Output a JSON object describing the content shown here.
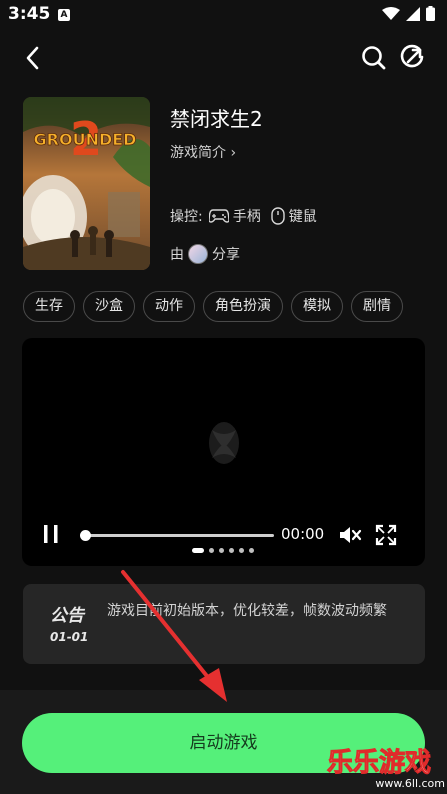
{
  "status_bar": {
    "time": "3:45",
    "badge": "A"
  },
  "nav": {
    "back_icon": "chevron-left-icon",
    "search_icon": "search-icon",
    "share_icon": "share-compass-icon"
  },
  "game": {
    "title": "禁闭求生2",
    "intro_link": "游戏简介 ›",
    "cover_text": "GROUNDED",
    "cover_number": "2",
    "controls_label": "操控:",
    "control_gamepad": "手柄",
    "control_mouse": "键鼠",
    "by_prefix": "由",
    "by_suffix": "分享"
  },
  "tags": [
    "生存",
    "沙盒",
    "动作",
    "角色扮演",
    "模拟",
    "剧情"
  ],
  "video": {
    "time": "00:00",
    "progress": 0.0,
    "dots_total": 6,
    "dot_active": 0
  },
  "notice": {
    "label": "公告",
    "date": "01-01",
    "text": "游戏目前初始版本，优化较差，帧数波动频繁"
  },
  "start_button": {
    "label": "启动游戏",
    "color": "#55f07a"
  },
  "watermark": {
    "text": "乐乐游戏",
    "url": "www.6ll.com"
  },
  "colors": {
    "background": "#111111",
    "accent": "#55f07a",
    "arrow": "#e53030"
  }
}
